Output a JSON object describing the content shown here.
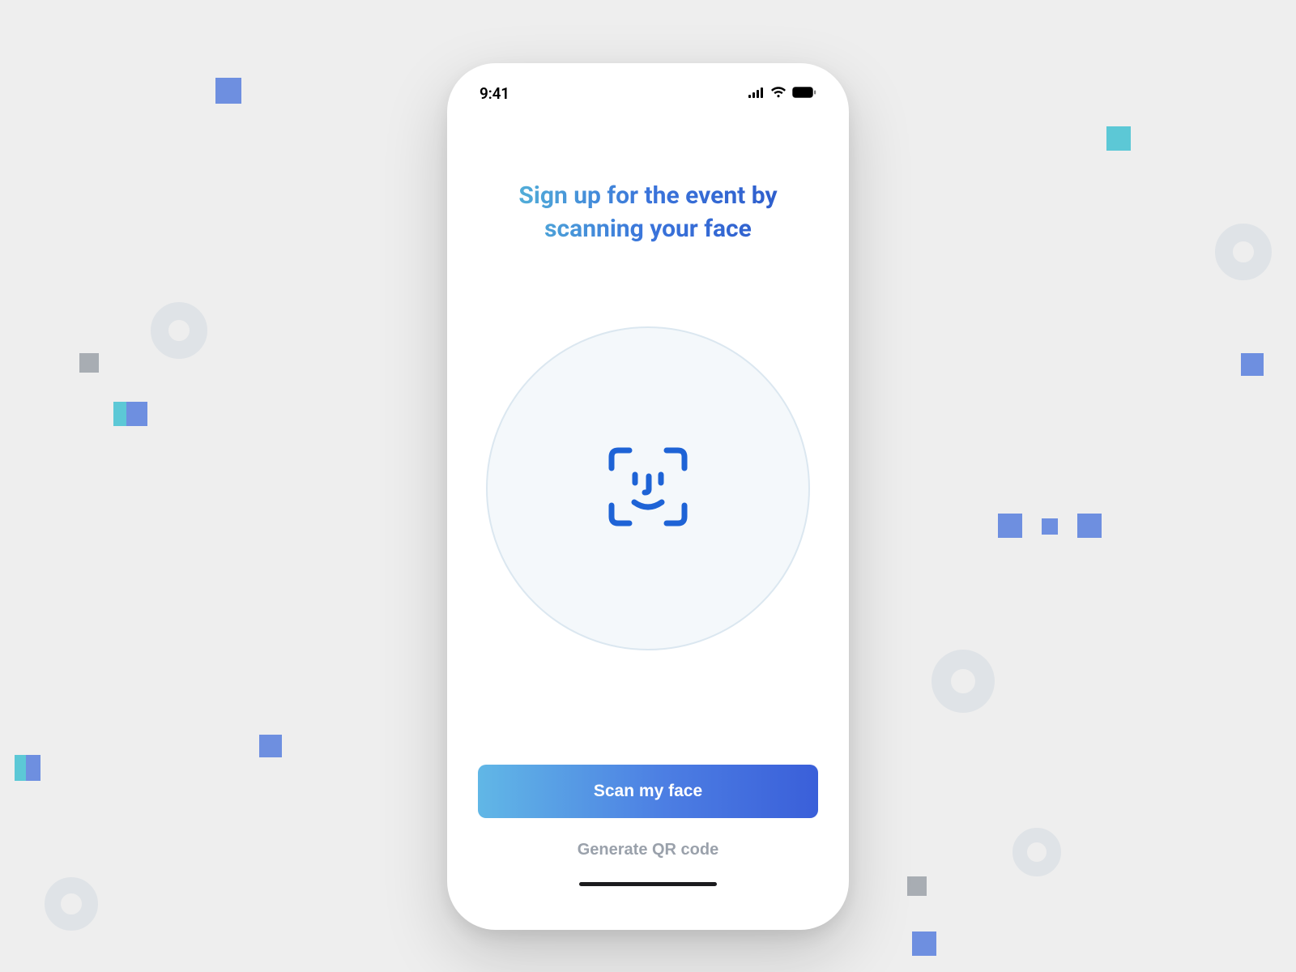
{
  "status": {
    "time": "9:41"
  },
  "headline": {
    "line1": "Sign up for the event by",
    "line2": "scanning your face"
  },
  "actions": {
    "primary": "Scan my face",
    "secondary": "Generate QR code"
  },
  "icons": {
    "face_id": "face-id-icon",
    "signal": "cellular-signal-icon",
    "wifi": "wifi-icon",
    "battery": "battery-icon"
  },
  "colors": {
    "gradient_start": "#61b7e6",
    "gradient_end": "#3a5fd9",
    "face_stroke": "#1e63d6"
  }
}
